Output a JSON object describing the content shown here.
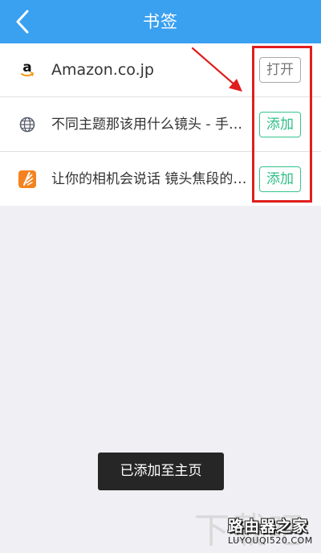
{
  "header": {
    "title": "书签",
    "back_icon": "chevron-left-icon"
  },
  "bookmarks": [
    {
      "title": "Amazon.co.jp",
      "icon": "amazon-icon",
      "button": "打开"
    },
    {
      "title": "不同主题那该用什么镜头 - 手…",
      "icon": "globe-icon",
      "button": "添加"
    },
    {
      "title": "让你的相机会说话 镜头焦段的…",
      "icon": "app-icon",
      "button": "添加"
    }
  ],
  "toast": "已添加至主页",
  "watermark": {
    "logo_text": "下载吧",
    "site_name": "路由器之家",
    "site_url": "LUYOUQI520.COM"
  },
  "colors": {
    "header_bg": "#3aa0f0",
    "annotation": "#e01e1e",
    "add_button": "#2fbf86",
    "open_button": "#777777"
  }
}
